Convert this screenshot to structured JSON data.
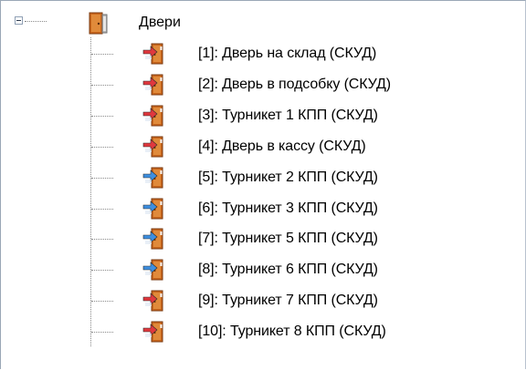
{
  "tree": {
    "root": {
      "label": "Двери",
      "icon": "folder-door-icon",
      "expanded": true
    },
    "children": [
      {
        "label": "[1]: Дверь  на склад (СКУД)",
        "icon": "door-enter-icon",
        "arrow_color": "#e0383e"
      },
      {
        "label": "[2]: Дверь в подсобку (СКУД)",
        "icon": "door-enter-icon",
        "arrow_color": "#e0383e"
      },
      {
        "label": "[3]: Турникет 1 КПП (СКУД)",
        "icon": "door-enter-icon",
        "arrow_color": "#e0383e"
      },
      {
        "label": "[4]: Дверь в кассу (СКУД)",
        "icon": "door-enter-icon",
        "arrow_color": "#e0383e"
      },
      {
        "label": "[5]: Турникет 2 КПП (СКУД)",
        "icon": "door-enter-icon",
        "arrow_color": "#3e8fe0"
      },
      {
        "label": "[6]: Турникет 3 КПП (СКУД)",
        "icon": "door-enter-icon",
        "arrow_color": "#3e8fe0"
      },
      {
        "label": "[7]: Турникет 5 КПП (СКУД)",
        "icon": "door-enter-icon",
        "arrow_color": "#3e8fe0"
      },
      {
        "label": "[8]: Турникет 6 КПП (СКУД)",
        "icon": "door-enter-icon",
        "arrow_color": "#3e8fe0"
      },
      {
        "label": "[9]: Турникет 7 КПП (СКУД)",
        "icon": "door-enter-icon",
        "arrow_color": "#e0383e"
      },
      {
        "label": "[10]: Турникет 8 КПП (СКУД)",
        "icon": "door-enter-icon",
        "arrow_color": "#e0383e"
      }
    ]
  }
}
